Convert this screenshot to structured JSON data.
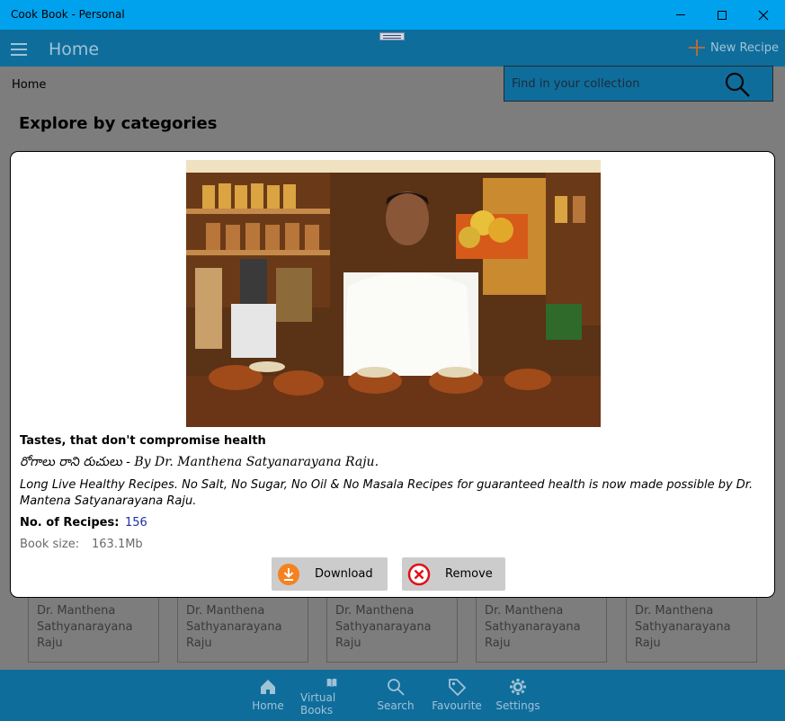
{
  "window": {
    "title": "Cook Book - Personal"
  },
  "header": {
    "title": "Home",
    "new_recipe_label": "New Recipe",
    "breadcrumb": "Home",
    "search_placeholder": "Find in your collection"
  },
  "main": {
    "section_title": "Explore by categories",
    "cards": [
      {
        "label": "Dr. Manthena Sathyanarayana Raju"
      },
      {
        "label": "Dr. Manthena Sathyanarayana Raju"
      },
      {
        "label": "Dr. Manthena Sathyanarayana Raju"
      },
      {
        "label": "Dr. Manthena Sathyanarayana Raju"
      },
      {
        "label": "Dr. Manthena Sathyanarayana Raju"
      }
    ]
  },
  "modal": {
    "title": "Tastes, that don't compromise health",
    "subtitle": "రోగాలు రాని రుచులు - By Dr. Manthena Satyanarayana Raju.",
    "description": "Long Live Healthy Recipes. No Salt, No Sugar, No Oil & No Masala Recipes for guaranteed health is now made possible by Dr. Mantena Satyanarayana Raju.",
    "recipes_label": "No. of Recipes:",
    "recipes_count": "156",
    "size_label": "Book size:",
    "size_value": "163.1Mb",
    "download_label": "Download",
    "remove_label": "Remove"
  },
  "bottom_nav": [
    {
      "label": "Home",
      "icon": "home-icon"
    },
    {
      "label": "Virtual Books",
      "icon": "book-icon"
    },
    {
      "label": "Search",
      "icon": "search-icon"
    },
    {
      "label": "Favourite",
      "icon": "tag-icon"
    },
    {
      "label": "Settings",
      "icon": "gear-icon"
    }
  ],
  "colors": {
    "titlebar": "#00a2ed",
    "header": "#0f6d9c",
    "accent_orange": "#f58220",
    "remove_red": "#e0101a"
  }
}
